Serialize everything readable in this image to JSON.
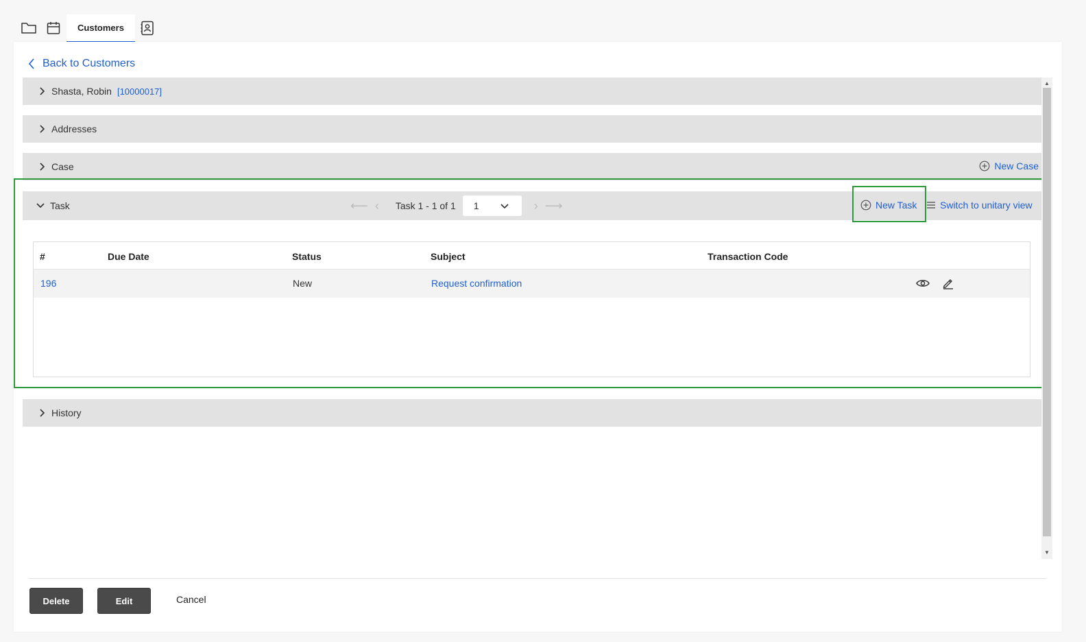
{
  "topbar": {
    "tabs": [
      {
        "icon": "folder-icon"
      },
      {
        "icon": "calendar-icon"
      },
      {
        "label": "Customers",
        "active": true
      },
      {
        "icon": "contact-card-icon"
      }
    ]
  },
  "back_link": "Back to Customers",
  "sections": {
    "customer": {
      "label": "Shasta, Robin",
      "id": "[10000017]"
    },
    "addresses": {
      "label": "Addresses"
    },
    "case": {
      "label": "Case",
      "action": "New Case"
    },
    "task": {
      "label": "Task",
      "pager_text": "Task 1 - 1 of 1",
      "page_value": "1",
      "new_task": "New Task",
      "switch_view": "Switch to unitary view"
    },
    "history": {
      "label": "History"
    }
  },
  "task_table": {
    "columns": [
      "#",
      "Due Date",
      "Status",
      "Subject",
      "Transaction Code"
    ],
    "rows": [
      {
        "id": "196",
        "due_date": "",
        "status": "New",
        "subject": "Request confirmation",
        "transaction_code": ""
      }
    ]
  },
  "footer": {
    "delete": "Delete",
    "edit": "Edit",
    "cancel": "Cancel"
  },
  "colors": {
    "accent": "#1f5fd0",
    "highlight": "#2e9a3c",
    "section_bg": "#e2e2e2",
    "button_dark": "#4a4a4a"
  }
}
